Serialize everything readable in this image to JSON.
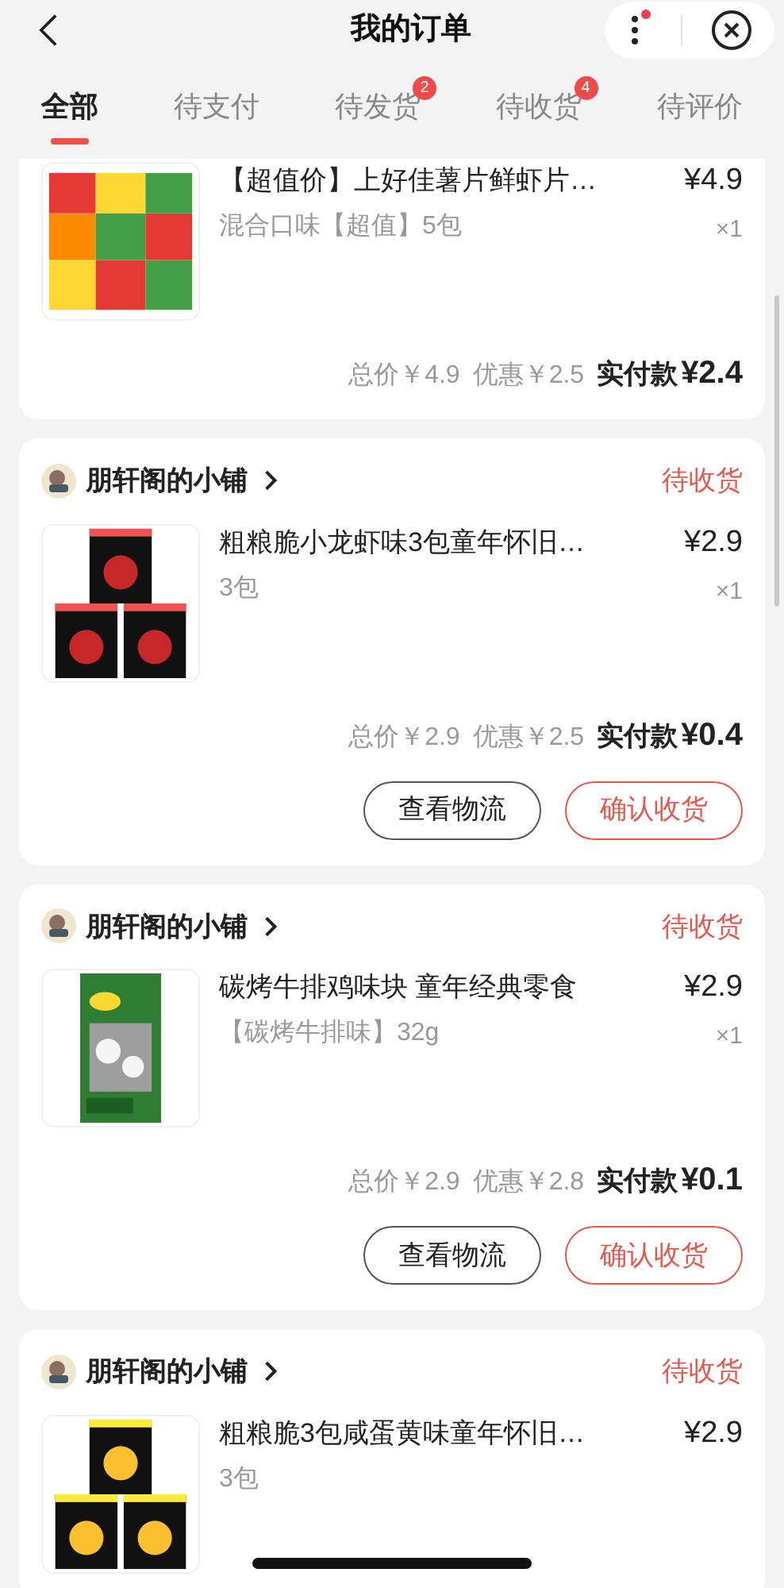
{
  "header": {
    "title": "我的订单"
  },
  "tabs": [
    {
      "label": "全部",
      "selected": true
    },
    {
      "label": "待支付",
      "selected": false
    },
    {
      "label": "待发货",
      "selected": false,
      "badge": "2"
    },
    {
      "label": "待收货",
      "selected": false,
      "badge": "4"
    },
    {
      "label": "待评价",
      "selected": false
    }
  ],
  "orders": [
    {
      "item": {
        "kind": "picture",
        "title": "【超值价】上好佳薯片鲜虾片…",
        "spec": "混合口味【超值】5包",
        "price": "¥4.9",
        "quantity": "×1"
      },
      "summary": {
        "total": "总价￥4.9",
        "discount": "优惠￥2.5",
        "paid_label": "实付款",
        "paid": "¥2.4"
      }
    },
    {
      "shop": "朋轩阁的小铺",
      "status": "待收货",
      "item": {
        "kind": "picture",
        "title": "粗粮脆小龙虾味3包童年怀旧…",
        "spec": "3包",
        "price": "¥2.9",
        "quantity": "×1"
      },
      "summary": {
        "total": "总价￥2.9",
        "discount": "优惠￥2.5",
        "paid_label": "实付款",
        "paid": "¥0.4"
      },
      "actions": [
        {
          "label": "查看物流",
          "primary": false
        },
        {
          "label": "确认收货",
          "primary": true
        }
      ]
    },
    {
      "shop": "朋轩阁的小铺",
      "status": "待收货",
      "item": {
        "kind": "picture",
        "title": "碳烤牛排鸡味块 童年经典零食",
        "spec": "【碳烤牛排味】32g",
        "price": "¥2.9",
        "quantity": "×1"
      },
      "summary": {
        "total": "总价￥2.9",
        "discount": "优惠￥2.8",
        "paid_label": "实付款",
        "paid": "¥0.1"
      },
      "actions": [
        {
          "label": "查看物流",
          "primary": false
        },
        {
          "label": "确认收货",
          "primary": true
        }
      ]
    },
    {
      "shop": "朋轩阁的小铺",
      "status": "待收货",
      "item": {
        "kind": "picture",
        "title": "粗粮脆3包咸蛋黄味童年怀旧…",
        "spec": "3包",
        "price": "¥2.9"
      }
    }
  ]
}
